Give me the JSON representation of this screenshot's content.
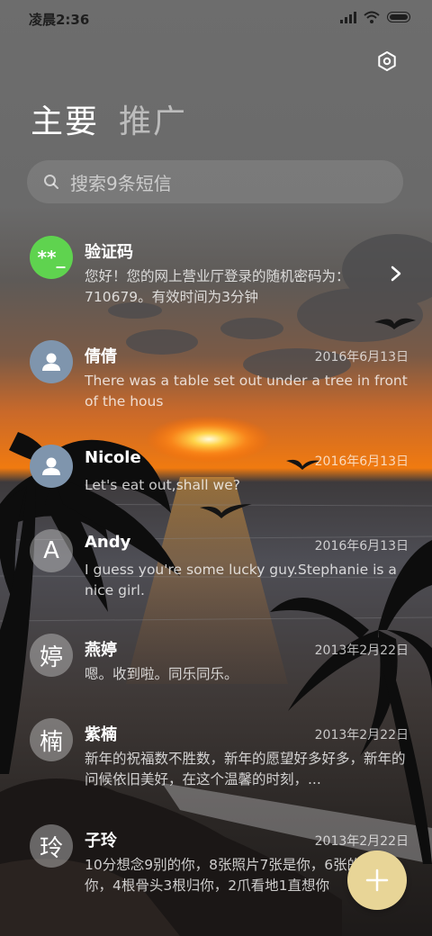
{
  "status_bar": {
    "time": "凌晨2:36"
  },
  "tabs": [
    {
      "label": "主要",
      "active": true
    },
    {
      "label": "推广",
      "active": false
    }
  ],
  "search": {
    "placeholder": "搜索9条短信"
  },
  "messages": [
    {
      "avatar_text": "**_",
      "avatar_style": "green",
      "name": "验证码",
      "date": "",
      "preview": "您好！您的网上营业厅登录的随机密码为：710679。有效时间为3分钟",
      "has_chevron": true
    },
    {
      "avatar_text": "",
      "avatar_style": "contact-icon",
      "name": "倩倩",
      "date": "2016年6月13日",
      "preview": "There was a table set out under a tree in front of the hous"
    },
    {
      "avatar_text": "",
      "avatar_style": "contact-icon",
      "name": "Nicole",
      "date": "2016年6月13日",
      "preview": "Let's eat out,shall we?"
    },
    {
      "avatar_text": "A",
      "avatar_style": "grey",
      "name": "Andy",
      "date": "2016年6月13日",
      "preview": "I guess you're some lucky guy.Stephanie is a nice girl."
    },
    {
      "avatar_text": "婷",
      "avatar_style": "grey",
      "name": "燕婷",
      "date": "2013年2月22日",
      "preview": "嗯。收到啦。同乐同乐。"
    },
    {
      "avatar_text": "楠",
      "avatar_style": "grey",
      "name": "紫楠",
      "date": "2013年2月22日",
      "preview": "新年的祝福数不胜数，新年的愿望好多好多，新年的问候依旧美好，在这个温馨的时刻，..."
    },
    {
      "avatar_text": "玲",
      "avatar_style": "grey",
      "name": "子玲",
      "date": "2013年2月22日",
      "preview": "10分想念9别的你，8张照片7张是你，6张的5只像你，4根骨头3根归你，2爪看地1直想你"
    }
  ],
  "colors": {
    "fab": "#e8d597",
    "green_avatar": "#5fd34f",
    "contact_avatar": "#7f95ad"
  },
  "icons": [
    "settings-icon",
    "search-icon",
    "chevron-right-icon",
    "contact-icon",
    "plus-icon",
    "signal-icon",
    "wifi-icon",
    "battery-icon"
  ]
}
